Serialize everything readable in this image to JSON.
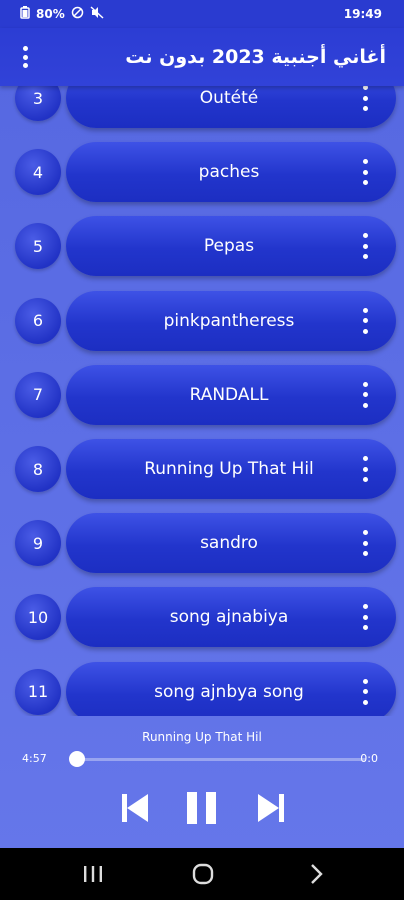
{
  "status": {
    "battery": "80%",
    "time": "19:49"
  },
  "appbar": {
    "title": "أغاني أجنبية 2023 بدون نت"
  },
  "tracks": [
    {
      "number": "3",
      "title": "Outété"
    },
    {
      "number": "4",
      "title": "paches"
    },
    {
      "number": "5",
      "title": "Pepas"
    },
    {
      "number": "6",
      "title": "pinkpantheress"
    },
    {
      "number": "7",
      "title": "RANDALL"
    },
    {
      "number": "8",
      "title": "Running Up That Hil"
    },
    {
      "number": "9",
      "title": "sandro"
    },
    {
      "number": "10",
      "title": "song ajnabiya"
    },
    {
      "number": "11",
      "title": "song ajnbya song"
    }
  ],
  "player": {
    "now_playing": "Running Up That Hil",
    "elapsed": "4:57",
    "remaining": "0:0",
    "progress": 0.0
  },
  "colors": {
    "bar": "#2c3dd4",
    "background": "#5d6fe6",
    "pill": "#2235cc"
  }
}
